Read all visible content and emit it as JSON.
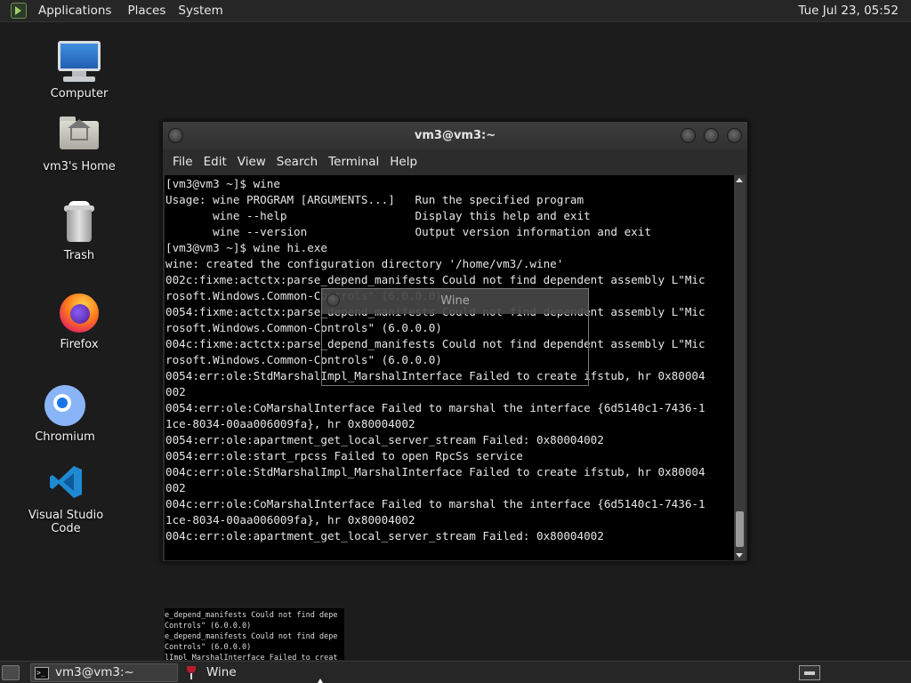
{
  "top_panel": {
    "menus": [
      "Applications",
      "Places",
      "System"
    ],
    "clock": "Tue Jul 23, 05:52"
  },
  "desktop_icons": [
    {
      "label": "Computer",
      "icon": "computer-icon"
    },
    {
      "label": "vm3's Home",
      "icon": "home-folder-icon"
    },
    {
      "label": "Trash",
      "icon": "trash-icon"
    },
    {
      "label": "Firefox",
      "icon": "firefox-icon"
    },
    {
      "label": "Chromium",
      "icon": "chromium-icon"
    },
    {
      "label": "Visual Studio Code",
      "icon": "vscode-icon"
    }
  ],
  "terminal": {
    "title": "vm3@vm3:~",
    "menu": [
      "File",
      "Edit",
      "View",
      "Search",
      "Terminal",
      "Help"
    ],
    "lines": [
      "[vm3@vm3 ~]$ wine",
      "Usage: wine PROGRAM [ARGUMENTS...]   Run the specified program",
      "       wine --help                   Display this help and exit",
      "       wine --version                Output version information and exit",
      "[vm3@vm3 ~]$ wine hi.exe",
      "wine: created the configuration directory '/home/vm3/.wine'",
      "002c:fixme:actctx:parse_depend_manifests Could not find dependent assembly L\"Mic",
      "rosoft.Windows.Common-Controls\" (6.0.0.0)",
      "0054:fixme:actctx:parse_depend_manifests Could not find dependent assembly L\"Mic",
      "rosoft.Windows.Common-Controls\" (6.0.0.0)",
      "004c:fixme:actctx:parse_depend_manifests Could not find dependent assembly L\"Mic",
      "rosoft.Windows.Common-Controls\" (6.0.0.0)",
      "0054:err:ole:StdMarshalImpl_MarshalInterface Failed to create ifstub, hr 0x80004",
      "002",
      "0054:err:ole:CoMarshalInterface Failed to marshal the interface {6d5140c1-7436-1",
      "1ce-8034-00aa006009fa}, hr 0x80004002",
      "0054:err:ole:apartment_get_local_server_stream Failed: 0x80004002",
      "0054:err:ole:start_rpcss Failed to open RpcSs service",
      "004c:err:ole:StdMarshalImpl_MarshalInterface Failed to create ifstub, hr 0x80004",
      "002",
      "004c:err:ole:CoMarshalInterface Failed to marshal the interface {6d5140c1-7436-1",
      "1ce-8034-00aa006009fa}, hr 0x80004002",
      "004c:err:ole:apartment_get_local_server_stream Failed: 0x80004002"
    ]
  },
  "wine_window": {
    "title": "Wine"
  },
  "thumbnail_lines": [
    "e_depend_manifests Could not find depe",
    "Controls\" (6.0.0.0)",
    "e_depend_manifests Could not find depe",
    "Controls\" (6.0.0.0)",
    "lImpl_MarshalInterface Failed to creat"
  ],
  "taskbar": {
    "tasks": [
      {
        "label": "vm3@vm3:~",
        "icon": "terminal-icon",
        "active": true
      },
      {
        "label": "Wine",
        "icon": "wine-icon",
        "active": false
      }
    ]
  }
}
